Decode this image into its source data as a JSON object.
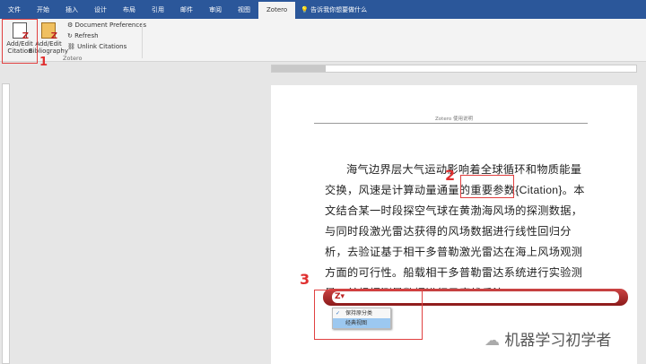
{
  "tabs": [
    "文件",
    "开始",
    "插入",
    "设计",
    "布局",
    "引用",
    "邮件",
    "审阅",
    "视图",
    "Zotero"
  ],
  "active_tab": "Zotero",
  "tell_me": "告诉我你想要做什么",
  "ribbon": {
    "add_edit_citation": "Add/Edit Citation",
    "add_edit_bibliography": "Add/Edit Bibliography",
    "document_preferences": "Document Preferences",
    "refresh": "Refresh",
    "unlink_citations": "Unlink Citations",
    "group_label": "Zotero"
  },
  "annotations": [
    "1",
    "2",
    "3"
  ],
  "page": {
    "header": "Zotero 使用说明",
    "paragraph_before": "海气边界层大气运动影响着全球循环和物质能量交换，风速是计算动量通量的重要参数",
    "citation": "{Citation}",
    "paragraph_after": "。本文结合某一时段探空气球在黄渤海风场的探测数据，与同时段激光雷达获得的风场数据进行线性回归分析，去验证基于相干多普勒激光雷达在海上风场观测方面的可行性。船载相干多普勒雷达系统进行实验测量，并根据测量数据进行风廓线反演。"
  },
  "zotero_bar": {
    "logo": "Z",
    "options": [
      "保持原分类",
      "经典视图"
    ],
    "selected": "经典视图"
  },
  "watermark": "机器学习初学者"
}
